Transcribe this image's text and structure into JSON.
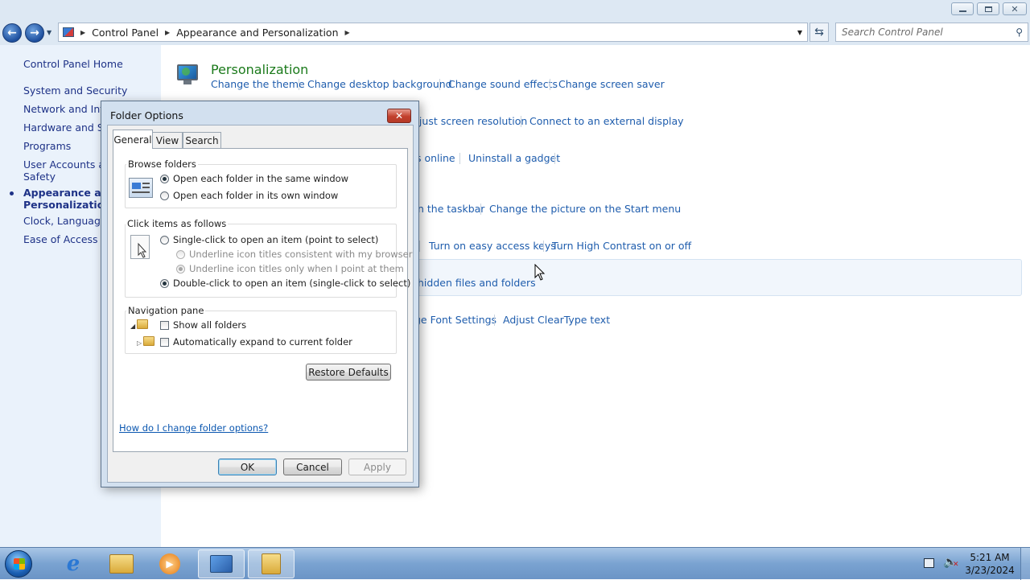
{
  "address": {
    "crumbs": [
      "Control Panel",
      "Appearance and Personalization"
    ]
  },
  "search": {
    "placeholder": "Search Control Panel"
  },
  "left_pane": {
    "home": "Control Panel Home",
    "items": [
      "System and Security",
      "Network and Inter",
      "Hardware and Sou",
      "Programs",
      "User Accounts and",
      "Safety",
      "Appearance and",
      "Personalization",
      "Clock, Language, a",
      "Ease of Access"
    ]
  },
  "main": {
    "personalization": {
      "title": "Personalization",
      "links": [
        "Change the theme",
        "Change desktop background",
        "Change sound effects",
        "Change screen saver"
      ]
    },
    "row_display": [
      "djust screen resolution",
      "Connect to an external display"
    ],
    "row_gadgets": [
      "s online",
      "Uninstall a gadget"
    ],
    "row_taskbar": [
      "n the taskbar",
      "Change the picture on the Start menu"
    ],
    "row_ease": [
      "Turn on easy access keys",
      "Turn High Contrast on or off"
    ],
    "row_folders": [
      "hidden files and folders"
    ],
    "row_fonts": [
      "ge Font Settings",
      "Adjust ClearType text"
    ]
  },
  "dialog": {
    "title": "Folder Options",
    "tabs": [
      "General",
      "View",
      "Search"
    ],
    "browse": {
      "label": "Browse folders",
      "opt1": "Open each folder in the same window",
      "opt2": "Open each folder in its own window"
    },
    "click": {
      "label": "Click items as follows",
      "opt1": "Single-click to open an item (point to select)",
      "sub1": "Underline icon titles consistent with my browser",
      "sub2": "Underline icon titles only when I point at them",
      "opt2": "Double-click to open an item (single-click to select)"
    },
    "nav": {
      "label": "Navigation pane",
      "opt1": "Show all folders",
      "opt2": "Automatically expand to current folder"
    },
    "restore": "Restore Defaults",
    "help": "How do I change folder options?",
    "ok": "OK",
    "cancel": "Cancel",
    "apply": "Apply"
  },
  "taskbar": {
    "time": "5:21 AM",
    "date": "3/23/2024"
  },
  "colors": {
    "link": "#1f5dad",
    "category_title": "#1b7a1b",
    "left_pane_bg": "#eaf2fb",
    "taskbar": "#7aa3d1"
  }
}
